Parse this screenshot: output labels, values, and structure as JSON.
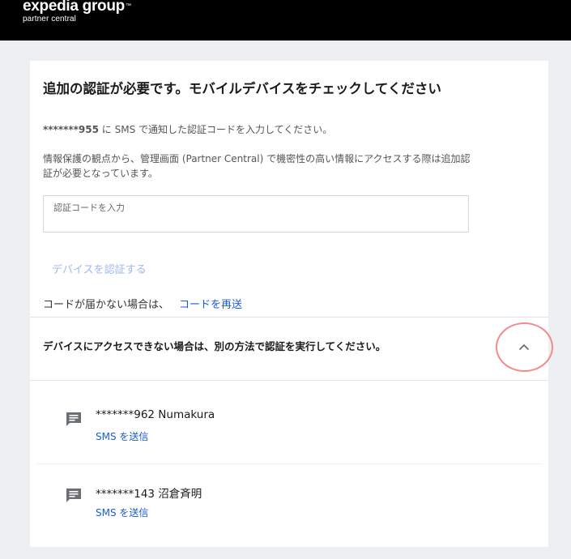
{
  "header": {
    "brand_name": "expedia group",
    "brand_tm": "™",
    "brand_sub": "partner central"
  },
  "verification": {
    "title": "追加の認証が必要です。モバイルデバイスをチェックしてください",
    "sms_masked": "*******955",
    "sms_note": " に SMS で通知した認証コードを入力してください。",
    "info": "情報保護の観点から、管理画面 (Partner Central) で機密性の高い情報にアクセスする際は追加認証が必要となっています。",
    "code_placeholder": "認証コードを入力",
    "verify_button": "デバイスを認証する",
    "resend_prompt": "コードが届かない場合は、",
    "resend_link": "コードを再送"
  },
  "alternatives": {
    "heading": "デバイスにアクセスできない場合は、別の方法で認証を実行してください。",
    "toggle_icon": "chevron-up-icon",
    "options": [
      {
        "name": "*******962 Numakura",
        "action": "SMS を送信",
        "icon": "message-icon"
      },
      {
        "name": "*******143 沼倉斉明",
        "action": "SMS を送信",
        "icon": "message-icon"
      }
    ]
  },
  "colors": {
    "link": "#1a5bd6",
    "disabled_button": "#9fb8ee",
    "highlight": "#f08c8c"
  }
}
